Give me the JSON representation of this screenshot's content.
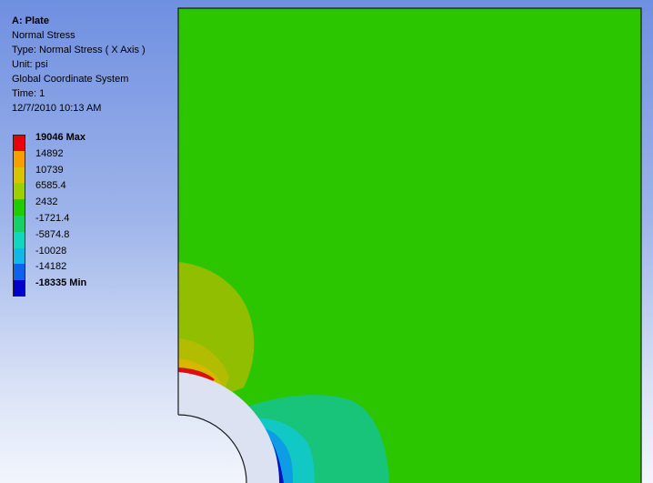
{
  "result": {
    "title": "A: Plate",
    "name": "Normal Stress",
    "type_line": "Type: Normal Stress ( X Axis )",
    "unit_line": "Unit: psi",
    "coordinate_system": "Global Coordinate System",
    "time_line": "Time: 1",
    "timestamp": "12/7/2010 10:13 AM"
  },
  "legend": [
    {
      "label": "19046 Max",
      "color": "#e8000a",
      "bold": true
    },
    {
      "label": "14892",
      "color": "#f6a000",
      "bold": false
    },
    {
      "label": "10739",
      "color": "#d8c400",
      "bold": false
    },
    {
      "label": "6585.4",
      "color": "#9ed000",
      "bold": false
    },
    {
      "label": "2432",
      "color": "#1ece00",
      "bold": false
    },
    {
      "label": "-1721.4",
      "color": "#16d068",
      "bold": false
    },
    {
      "label": "-5874.8",
      "color": "#10d8c0",
      "bold": false
    },
    {
      "label": "-10028",
      "color": "#12b8e8",
      "bold": false
    },
    {
      "label": "-14182",
      "color": "#0f62ec",
      "bold": false
    },
    {
      "label": "-18335 Min",
      "color": "#0000cc",
      "bold": true
    }
  ],
  "contour_colors": {
    "background_field": "#2cc600",
    "high_1": "#92be00",
    "high_2": "#b2bc00",
    "high_3": "#d6b800",
    "high_4": "#c89600",
    "max_band": "#dc0f0f",
    "low_1": "#18c47a",
    "low_2": "#12c8c4",
    "low_3": "#0e9ce4",
    "min_band": "#0014c0",
    "hole": "#dde2f2"
  }
}
